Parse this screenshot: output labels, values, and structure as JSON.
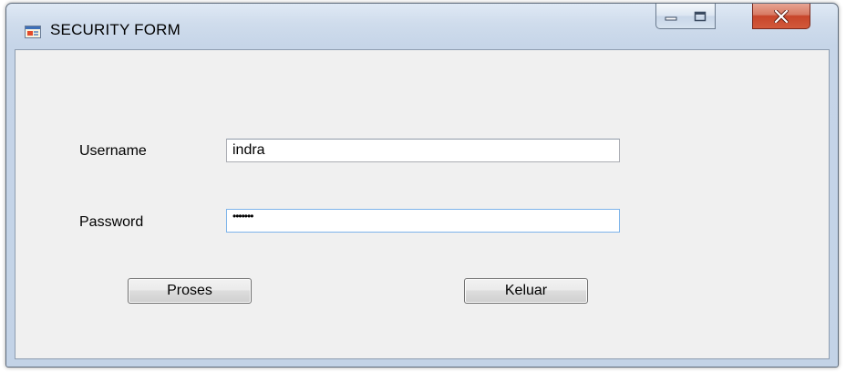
{
  "window": {
    "title": "SECURITY FORM",
    "icon": "form-app-icon",
    "controls": {
      "minimize_icon": "minimize-icon",
      "maximize_icon": "maximize-icon",
      "close_icon": "close-icon",
      "close_color": "#c7452a"
    }
  },
  "form": {
    "username": {
      "label": "Username",
      "value": "indra"
    },
    "password": {
      "label": "Password",
      "masked_value": "•••••••"
    },
    "buttons": {
      "proses_label": "Proses",
      "keluar_label": "Keluar"
    }
  }
}
